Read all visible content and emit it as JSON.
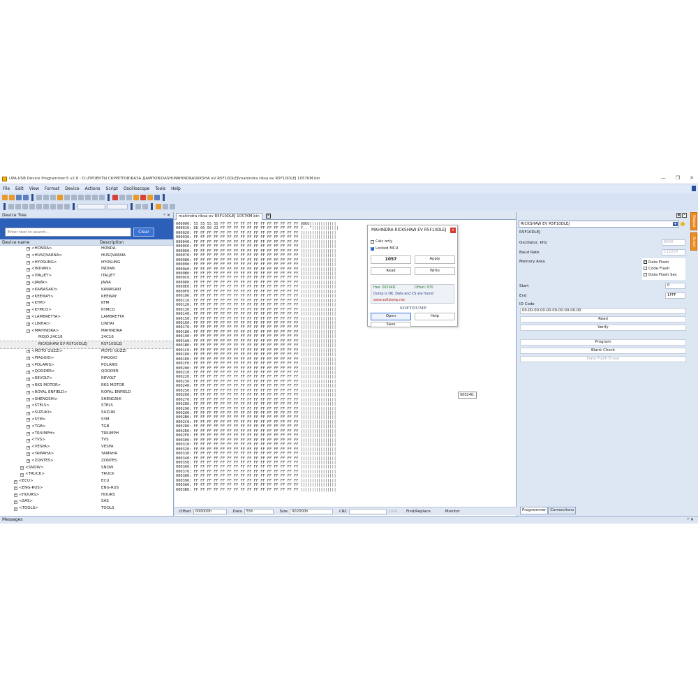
{
  "window": {
    "title": "UPA-USB Device Programmer-5 v2.8 - D:\\ПРОЕКТЫ СКРИПТОВ\\БАЗА ДАМПОВ\\DASH\\MAHINDRA\\RIKSHA eV R5F10DLEJ\\mahindra riksa ev R5F10DLEJ 1057KM.bin",
    "minimize": "—",
    "restore": "❐",
    "close": "✕"
  },
  "menu": [
    "File",
    "Edit",
    "View",
    "Format",
    "Device",
    "Actions",
    "Script",
    "Oscilloscope",
    "Tools",
    "Help"
  ],
  "device_tree": {
    "header": "Device Tree",
    "pin_close": "ᵖ ✕",
    "search_placeholder": "Enter text to search...",
    "clear_label": "Clear",
    "col_name": "Device name",
    "col_desc": "Description",
    "rows": [
      {
        "name": "<HONDA>",
        "desc": "HONDA",
        "level": 2,
        "exp": "+"
      },
      {
        "name": "<HUSQVARNA>",
        "desc": "HUSQVARNA",
        "level": 2,
        "exp": "+"
      },
      {
        "name": "<HYOSUNG>",
        "desc": "HYOSUNG",
        "level": 2,
        "exp": "+"
      },
      {
        "name": "<INDIAN>",
        "desc": "INDIAN",
        "level": 2,
        "exp": "+"
      },
      {
        "name": "<ITALJET>",
        "desc": "ITALJET",
        "level": 2,
        "exp": "+"
      },
      {
        "name": "<JAWA>",
        "desc": "JAWA",
        "level": 2,
        "exp": "+"
      },
      {
        "name": "<KAWASAKI>",
        "desc": "KAWASAKI",
        "level": 2,
        "exp": "+"
      },
      {
        "name": "<KEEWAY>",
        "desc": "KEEWAY",
        "level": 2,
        "exp": "+"
      },
      {
        "name": "<KTM>",
        "desc": "KTM",
        "level": 2,
        "exp": "+"
      },
      {
        "name": "<KYMCO>",
        "desc": "KYMCO",
        "level": 2,
        "exp": "+"
      },
      {
        "name": "<LAMBRETTA>",
        "desc": "LAMBRETTA",
        "level": 2,
        "exp": "+"
      },
      {
        "name": "<LINHAI>",
        "desc": "LINHAI",
        "level": 2,
        "exp": "+"
      },
      {
        "name": "<MAHINDRA>",
        "desc": "MAHINDRA",
        "level": 2,
        "exp": "−"
      },
      {
        "name": "MOJO 24C16",
        "desc": "24C16",
        "level": 3,
        "exp": ""
      },
      {
        "name": "RICKSHAW EV R5F10DLEJ",
        "desc": "R5F10DLEJ",
        "level": 3,
        "exp": "",
        "selected": true
      },
      {
        "name": "<MOTO GUZZI>",
        "desc": "MOTO GUZZI",
        "level": 2,
        "exp": "+"
      },
      {
        "name": "<PIAGGIO>",
        "desc": "PIAGGIO",
        "level": 2,
        "exp": "+"
      },
      {
        "name": "<POLARIS>",
        "desc": "POLARIS",
        "level": 2,
        "exp": "+"
      },
      {
        "name": "<QOODER>",
        "desc": "QOODER",
        "level": 2,
        "exp": "+"
      },
      {
        "name": "<REVOLT>",
        "desc": "REVOLT",
        "level": 2,
        "exp": "+"
      },
      {
        "name": "<RKS MOTOR>",
        "desc": "RKS MOTOR",
        "level": 2,
        "exp": "+"
      },
      {
        "name": "<ROYAL ENFIELD>",
        "desc": "ROYAL ENFIELD",
        "level": 2,
        "exp": "+"
      },
      {
        "name": "<SHENGSHI>",
        "desc": "SHENGSHI",
        "level": 2,
        "exp": "+"
      },
      {
        "name": "<STELS>",
        "desc": "STELS",
        "level": 2,
        "exp": "+"
      },
      {
        "name": "<SUZUKI>",
        "desc": "SUZUKI",
        "level": 2,
        "exp": "+"
      },
      {
        "name": "<SYM>",
        "desc": "SYM",
        "level": 2,
        "exp": "+"
      },
      {
        "name": "<TGB>",
        "desc": "TGB",
        "level": 2,
        "exp": "+"
      },
      {
        "name": "<TRIUMPH>",
        "desc": "TRIUMPH",
        "level": 2,
        "exp": "+"
      },
      {
        "name": "<TVS>",
        "desc": "TVS",
        "level": 2,
        "exp": "+"
      },
      {
        "name": "<VESPA>",
        "desc": "VESPA",
        "level": 2,
        "exp": "+"
      },
      {
        "name": "<YAMAHA>",
        "desc": "YAMAHA",
        "level": 2,
        "exp": "+"
      },
      {
        "name": "<ZONTES>",
        "desc": "ZONTES",
        "level": 2,
        "exp": "+"
      },
      {
        "name": "<SNOW>",
        "desc": "SNOW",
        "level": 1,
        "exp": "+"
      },
      {
        "name": "<TRUCK>",
        "desc": "TRUCK",
        "level": 1,
        "exp": "+"
      },
      {
        "name": "<ECU>",
        "desc": "ECU",
        "level": 0,
        "exp": "+"
      },
      {
        "name": "<ENG-RUS>",
        "desc": "ENG-RUS",
        "level": 0,
        "exp": "+"
      },
      {
        "name": "<HOURS>",
        "desc": "HOURS",
        "level": 0,
        "exp": "+"
      },
      {
        "name": "<SAS>",
        "desc": "SAS",
        "level": 0,
        "exp": "+"
      },
      {
        "name": "<TOOLS>",
        "desc": "TOOLS",
        "level": 0,
        "exp": "+"
      }
    ]
  },
  "editor": {
    "tab_label": "mahindra riksa ev R5F10DLEJ 1057KM.bin",
    "tab_close": "✕",
    "hex_lines": [
      {
        "off": "000000:",
        "bytes": "55 55 55 55 FF FF FF FF FF FF FF FF FF FF FF FF",
        "asc": "UUUU||||||||||||"
      },
      {
        "off": "000010:",
        "bytes": "DD 00 00 22 FF FF FF FF FF FF FF FF FF FF FF FF",
        "asc": "Ý.. \"||||||||||||"
      },
      {
        "off": "000020:",
        "bytes": "FF FF FF FF FF FF FF FF FF FF FF FF FF FF FF FF",
        "asc": "||||||||||||||||"
      },
      {
        "off": "000030:",
        "bytes": "FF FF FF FF FF FF FF FF FF FF FF FF FF FF FF FF",
        "asc": "||||||||||||||||"
      },
      {
        "off": "000040:",
        "bytes": "FF FF FF FF FF FF FF FF FF FF FF FF FF FF FF FF",
        "asc": "||||||||||||||||"
      },
      {
        "off": "000050:",
        "bytes": "FF FF FF FF FF FF FF FF FF FF FF FF FF FF FF FF",
        "asc": "||||||||||||||||"
      },
      {
        "off": "000060:",
        "bytes": "FF FF FF FF FF FF FF FF FF FF FF FF FF FF FF FF",
        "asc": "||||||||||||||||"
      },
      {
        "off": "000070:",
        "bytes": "FF FF FF FF FF FF FF FF FF FF FF FF FF FF FF FF",
        "asc": "||||||||||||||||"
      },
      {
        "off": "000080:",
        "bytes": "FF FF FF FF FF FF FF FF FF FF FF FF FF FF FF FF",
        "asc": "||||||||||||||||"
      },
      {
        "off": "000090:",
        "bytes": "FF FF FF FF FF FF FF FF FF FF FF FF FF FF FF FF",
        "asc": "||||||||||||||||"
      },
      {
        "off": "0000A0:",
        "bytes": "FF FF FF FF FF FF FF FF FF FF FF FF FF FF FF FF",
        "asc": "||||||||||||||||"
      },
      {
        "off": "0000B0:",
        "bytes": "FF FF FF FF FF FF FF FF FF FF FF FF FF FF FF FF",
        "asc": "||||||||||||||||"
      },
      {
        "off": "0000C0:",
        "bytes": "FF FF FF FF FF FF FF FF FF FF FF FF FF FF FF FF",
        "asc": "||||||||||||||||"
      },
      {
        "off": "0000D0:",
        "bytes": "FF FF FF FF FF FF FF FF FF FF FF FF FF FF FF FF",
        "asc": "||||||||||||||||"
      },
      {
        "off": "0000E0:",
        "bytes": "FF FF FF FF FF FF FF FF FF FF FF FF FF FF FF FF",
        "asc": "||||||||||||||||"
      },
      {
        "off": "0000F0:",
        "bytes": "FF FF FF FF FF FF FF FF FF FF FF FF FF FF FF FF",
        "asc": "||||||||||||||||"
      },
      {
        "off": "000100:",
        "bytes": "FF FF FF FF FF FF FF FF FF FF FF FF FF FF FF FF",
        "asc": "||||||||||||||||"
      },
      {
        "off": "000110:",
        "bytes": "FF FF FF FF FF FF FF FF FF FF FF FF FF FF FF FF",
        "asc": "||||||||||||||||"
      },
      {
        "off": "000120:",
        "bytes": "FF FF FF FF FF FF FF FF FF FF FF FF FF FF FF FF",
        "asc": "||||||||||||||||"
      },
      {
        "off": "000130:",
        "bytes": "FF FF FF FF FF FF FF FF FF FF FF FF FF FF FF FF",
        "asc": "||||||||||||||||"
      },
      {
        "off": "000140:",
        "bytes": "FF FF FF FF FF FF FF FF FF FF FF FF FF FF FF FF",
        "asc": "||||||||||||||||"
      },
      {
        "off": "000150:",
        "bytes": "FF FF FF FF FF FF FF FF FF FF FF FF FF FF FF FF",
        "asc": "||||||||||||||||"
      },
      {
        "off": "000160:",
        "bytes": "FF FF FF FF FF FF FF FF FF FF FF FF FF FF FF FF",
        "asc": "||||||||||||||||"
      },
      {
        "off": "000170:",
        "bytes": "FF FF FF FF FF FF FF FF FF FF FF FF FF FF FF FF",
        "asc": "||||||||||||||||"
      },
      {
        "off": "000180:",
        "bytes": "FF FF FF FF FF FF FF FF FF FF FF FF FF FF FF FF",
        "asc": "||||||||||||||||"
      },
      {
        "off": "000190:",
        "bytes": "FF FF FF FF FF FF FF FF FF FF FF FF FF FF FF FF",
        "asc": "||||||||||||||||"
      },
      {
        "off": "0001A0:",
        "bytes": "FF FF FF FF FF FF FF FF FF FF FF FF FF FF FF FF",
        "asc": "||||||||||||||||"
      },
      {
        "off": "0001B0:",
        "bytes": "FF FF FF FF FF FF FF FF FF FF FF FF FF FF FF FF",
        "asc": "||||||||||||||||"
      },
      {
        "off": "0001C0:",
        "bytes": "FF FF FF FF FF FF FF FF FF FF FF FF FF FF FF FF",
        "asc": "||||||||||||||||"
      },
      {
        "off": "0001D0:",
        "bytes": "FF FF FF FF FF FF FF FF FF FF FF FF FF FF FF FF",
        "asc": "||||||||||||||||"
      },
      {
        "off": "0001E0:",
        "bytes": "FF FF FF FF FF FF FF FF FF FF FF FF FF FF FF FF",
        "asc": "||||||||||||||||"
      },
      {
        "off": "0001F0:",
        "bytes": "FF FF FF FF FF FF FF FF FF FF FF FF FF FF FF FF",
        "asc": "||||||||||||||||"
      },
      {
        "off": "000200:",
        "bytes": "FF FF FF FF FF FF FF FF FF FF FF FF FF FF FF FF",
        "asc": "||||||||||||||||"
      },
      {
        "off": "000210:",
        "bytes": "FF FF FF FF FF FF FF FF FF FF FF FF FF FF FF FF",
        "asc": "||||||||||||||||"
      },
      {
        "off": "000220:",
        "bytes": "FF FF FF FF FF FF FF FF FF FF FF FF FF FF FF FF",
        "asc": "||||||||||||||||"
      },
      {
        "off": "000230:",
        "bytes": "FF FF FF FF FF FF FF FF FF FF FF FF FF FF FF FF",
        "asc": "||||||||||||||||"
      },
      {
        "off": "000240:",
        "bytes": "FF FF FF FF FF FF FF FF FF FF FF FF FF FF FF FF",
        "asc": "||||||||||||||||"
      },
      {
        "off": "000250:",
        "bytes": "FF FF FF FF FF FF FF FF FF FF FF FF FF FF FF FF",
        "asc": "||||||||||||||||"
      },
      {
        "off": "000260:",
        "bytes": "FF FF FF FF FF FF FF FF FF FF FF FF FF FF FF FF",
        "asc": "||||||||||||||||"
      },
      {
        "off": "000270:",
        "bytes": "FF FF FF FF FF FF FF FF FF FF FF FF FF FF FF FF",
        "asc": "||||||||||||||||"
      },
      {
        "off": "000280:",
        "bytes": "FF FF FF FF FF FF FF FF FF FF FF FF FF FF FF FF",
        "asc": "||||||||||||||||"
      },
      {
        "off": "000290:",
        "bytes": "FF FF FF FF FF FF FF FF FF FF FF FF FF FF FF FF",
        "asc": "||||||||||||||||"
      },
      {
        "off": "0002A0:",
        "bytes": "FF FF FF FF FF FF FF FF FF FF FF FF FF FF FF FF",
        "asc": "||||||||||||||||"
      },
      {
        "off": "0002B0:",
        "bytes": "FF FF FF FF FF FF FF FF FF FF FF FF FF FF FF FF",
        "asc": "||||||||||||||||"
      },
      {
        "off": "0002C0:",
        "bytes": "FF FF FF FF FF FF FF FF FF FF FF FF FF FF FF FF",
        "asc": "||||||||||||||||"
      },
      {
        "off": "0002D0:",
        "bytes": "FF FF FF FF FF FF FF FF FF FF FF FF FF FF FF FF",
        "asc": "||||||||||||||||"
      },
      {
        "off": "0002E0:",
        "bytes": "FF FF FF FF FF FF FF FF FF FF FF FF FF FF FF FF",
        "asc": "||||||||||||||||"
      },
      {
        "off": "0002F0:",
        "bytes": "FF FF FF FF FF FF FF FF FF FF FF FF FF FF FF FF",
        "asc": "||||||||||||||||"
      },
      {
        "off": "000300:",
        "bytes": "FF FF FF FF FF FF FF FF FF FF FF FF FF FF FF FF",
        "asc": "||||||||||||||||"
      },
      {
        "off": "000310:",
        "bytes": "FF FF FF FF FF FF FF FF FF FF FF FF FF FF FF FF",
        "asc": "||||||||||||||||"
      },
      {
        "off": "000320:",
        "bytes": "FF FF FF FF FF FF FF FF FF FF FF FF FF FF FF FF",
        "asc": "||||||||||||||||"
      },
      {
        "off": "000330:",
        "bytes": "FF FF FF FF FF FF FF FF FF FF FF FF FF FF FF FF",
        "asc": "||||||||||||||||"
      },
      {
        "off": "000340:",
        "bytes": "FF FF FF FF FF FF FF FF FF FF FF FF FF FF FF FF",
        "asc": "||||||||||||||||"
      },
      {
        "off": "000350:",
        "bytes": "FF FF FF FF FF FF FF FF FF FF FF FF FF FF FF FF",
        "asc": "||||||||||||||||"
      },
      {
        "off": "000360:",
        "bytes": "FF FF FF FF FF FF FF FF FF FF FF FF FF FF FF FF",
        "asc": "||||||||||||||||"
      },
      {
        "off": "000370:",
        "bytes": "FF FF FF FF FF FF FF FF FF FF FF FF FF FF FF FF",
        "asc": "||||||||||||||||"
      },
      {
        "off": "000380:",
        "bytes": "FF FF FF FF FF FF FF FF FF FF FF FF FF FF FF FF",
        "asc": "||||||||||||||||"
      },
      {
        "off": "000390:",
        "bytes": "FF FF FF FF FF FF FF FF FF FF FF FF FF FF FF FF",
        "asc": "||||||||||||||||"
      },
      {
        "off": "0003A0:",
        "bytes": "FF FF FF FF FF FF FF FF FF FF FF FF FF FF FF FF",
        "asc": "||||||||||||||||"
      },
      {
        "off": "0003B0:",
        "bytes": "FF FF FF FF FF FF FF FF FF FF FF FF FF FF FF FF",
        "asc": "||||||||||||||||"
      }
    ],
    "tooltip": "000240:",
    "status": {
      "offset_label": "Offset",
      "offset_value": "000000h",
      "data_label": "Data",
      "data_value": "55h",
      "size_label": "Size",
      "size_value": "002000h",
      "crc_label": "CRC",
      "crc_value": "",
      "ovr_label": "OVR",
      "find_label": "Find/Replace",
      "monitor_label": "Monitor"
    }
  },
  "dialog": {
    "title": "MAHINDRA RICKSHAW EV R5F10DLEJ",
    "close": "×",
    "calc_only": "Calc only",
    "locked_mcu": "Locked MCU",
    "km_value": "1057",
    "apply": "Apply",
    "read": "Read",
    "write": "Write",
    "hex_text": "Hex: 00294D",
    "offset_text": "Offset: 970",
    "ok_text": "Dump is OK. Data and CS are found",
    "url_text": "www.softdump.net",
    "brand": "SOFTDUMP",
    "open": "Open",
    "help": "Help",
    "save": "Save"
  },
  "programmer": {
    "device_select": "RICKSHAW EV R5F10DLEJ",
    "device_name": "R5F10DLEJ",
    "oscillator_label": "Oscillator, kHz",
    "oscillator_value": "8000",
    "baud_label": "Baud Rate",
    "baud_value": "115200",
    "memory_area_label": "Memory Area",
    "mem_options": [
      {
        "label": "Data Flash",
        "checked": true
      },
      {
        "label": "Code Flash",
        "checked": false
      },
      {
        "label": "Data Flash Sec",
        "checked": false
      }
    ],
    "start_label": "Start",
    "start_value": "0",
    "end_label": "End",
    "end_value": "1FFF",
    "id_code_label": "ID Code",
    "id_code_value": "00-00-00-00-00-00-00-00-00-00",
    "read": "Read",
    "verify": "Verify",
    "program": "Program",
    "blank_check": "Blank Check",
    "data_flash_erase": "Data Flash Erase",
    "tabs": [
      "Programmer",
      "Connections"
    ],
    "side_tabs": [
      "Output",
      "Script"
    ]
  },
  "messages": {
    "label": "Messages",
    "pin_close": "ᵖ ✕"
  },
  "colors": {
    "search_band": "#2b5fb8",
    "side_tab": "#f08c1e",
    "ok_green": "#2e7d32",
    "url_red": "#b3261e"
  }
}
